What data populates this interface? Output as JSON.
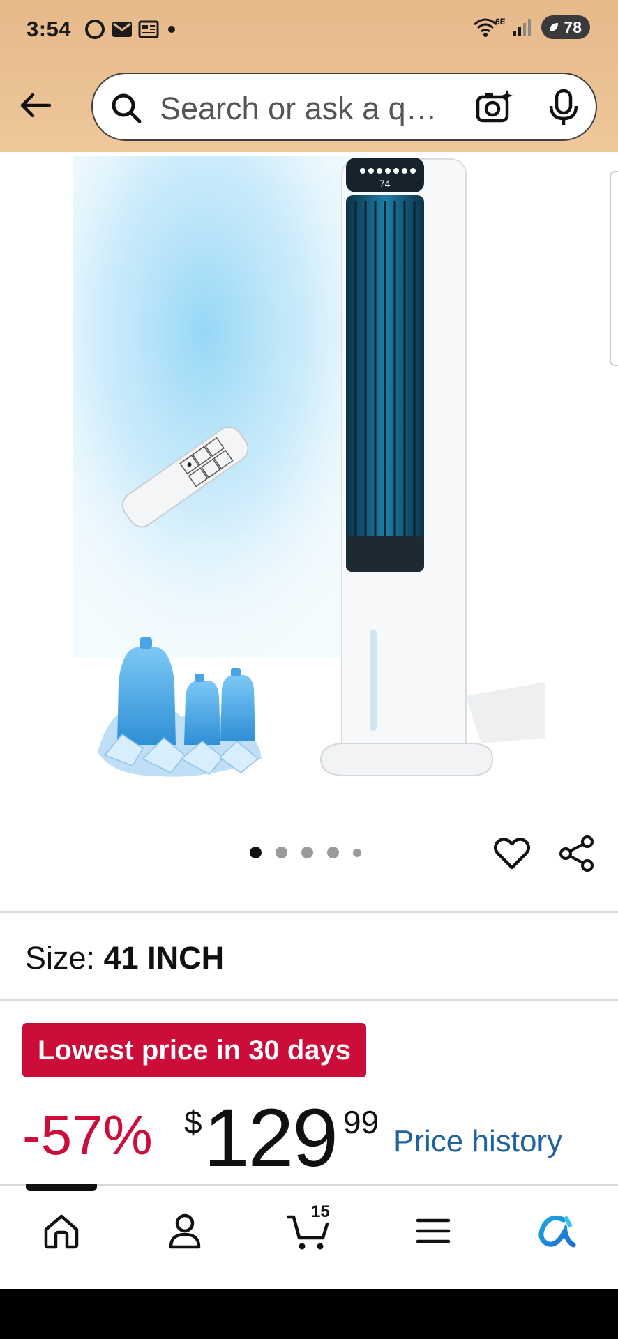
{
  "status_bar": {
    "time": "3:54",
    "network_label": "6E",
    "battery_level": "78"
  },
  "search": {
    "placeholder": "Search or ask a q…"
  },
  "carousel": {
    "dot_count": 5,
    "active_index": 0
  },
  "size": {
    "label": "Size:",
    "value": "41 INCH"
  },
  "deal": {
    "badge_text": "Lowest price in 30 days"
  },
  "price": {
    "discount": "-57%",
    "currency_symbol": "$",
    "whole": "129",
    "fraction": "99",
    "history_link": "Price history"
  },
  "bottom_nav": {
    "cart_count": "15",
    "items": [
      "home-icon",
      "account-icon",
      "cart-icon",
      "menu-icon",
      "rufus-icon"
    ]
  },
  "colors": {
    "header_bg": "#eec79b",
    "deal_red": "#cc0c39",
    "link_blue": "#2162a1"
  }
}
